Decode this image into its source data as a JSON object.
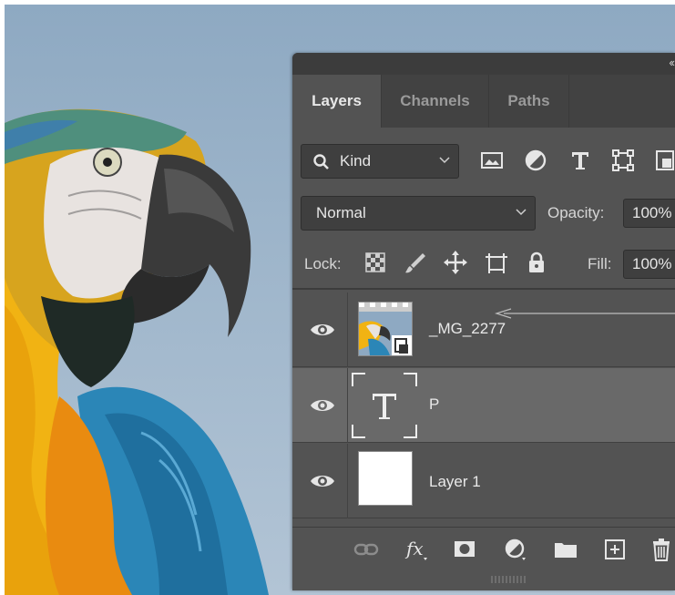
{
  "panel": {
    "tabs": [
      {
        "label": "Layers",
        "active": true
      },
      {
        "label": "Channels",
        "active": false
      },
      {
        "label": "Paths",
        "active": false
      }
    ],
    "filter": {
      "kind_label": "Kind",
      "icons": [
        "image-filter-icon",
        "adjustment-filter-icon",
        "type-filter-icon",
        "shape-filter-icon",
        "smart-object-filter-icon"
      ]
    },
    "blend_mode": "Normal",
    "opacity_label": "Opacity:",
    "opacity_value": "100%",
    "lock_label": "Lock:",
    "lock_icons": [
      "lock-transparent-pixels-icon",
      "lock-image-pixels-icon",
      "lock-position-icon",
      "lock-artboard-icon",
      "lock-all-icon"
    ],
    "fill_label": "Fill:",
    "fill_value": "100%",
    "layers": [
      {
        "name": "_MG_2277",
        "type": "smart-object",
        "visible": true,
        "selected": false
      },
      {
        "name": "P",
        "type": "text",
        "visible": true,
        "selected": true
      },
      {
        "name": "Layer 1",
        "type": "pixel",
        "visible": true,
        "selected": false
      }
    ],
    "footer_icons": [
      "link-layers-icon",
      "fx-icon",
      "add-mask-icon",
      "adjustment-layer-icon",
      "group-folder-icon",
      "new-layer-icon",
      "delete-layer-icon"
    ]
  },
  "colors": {
    "panel_bg": "#535353",
    "tab_bar": "#424242",
    "selected_row": "#696969"
  }
}
